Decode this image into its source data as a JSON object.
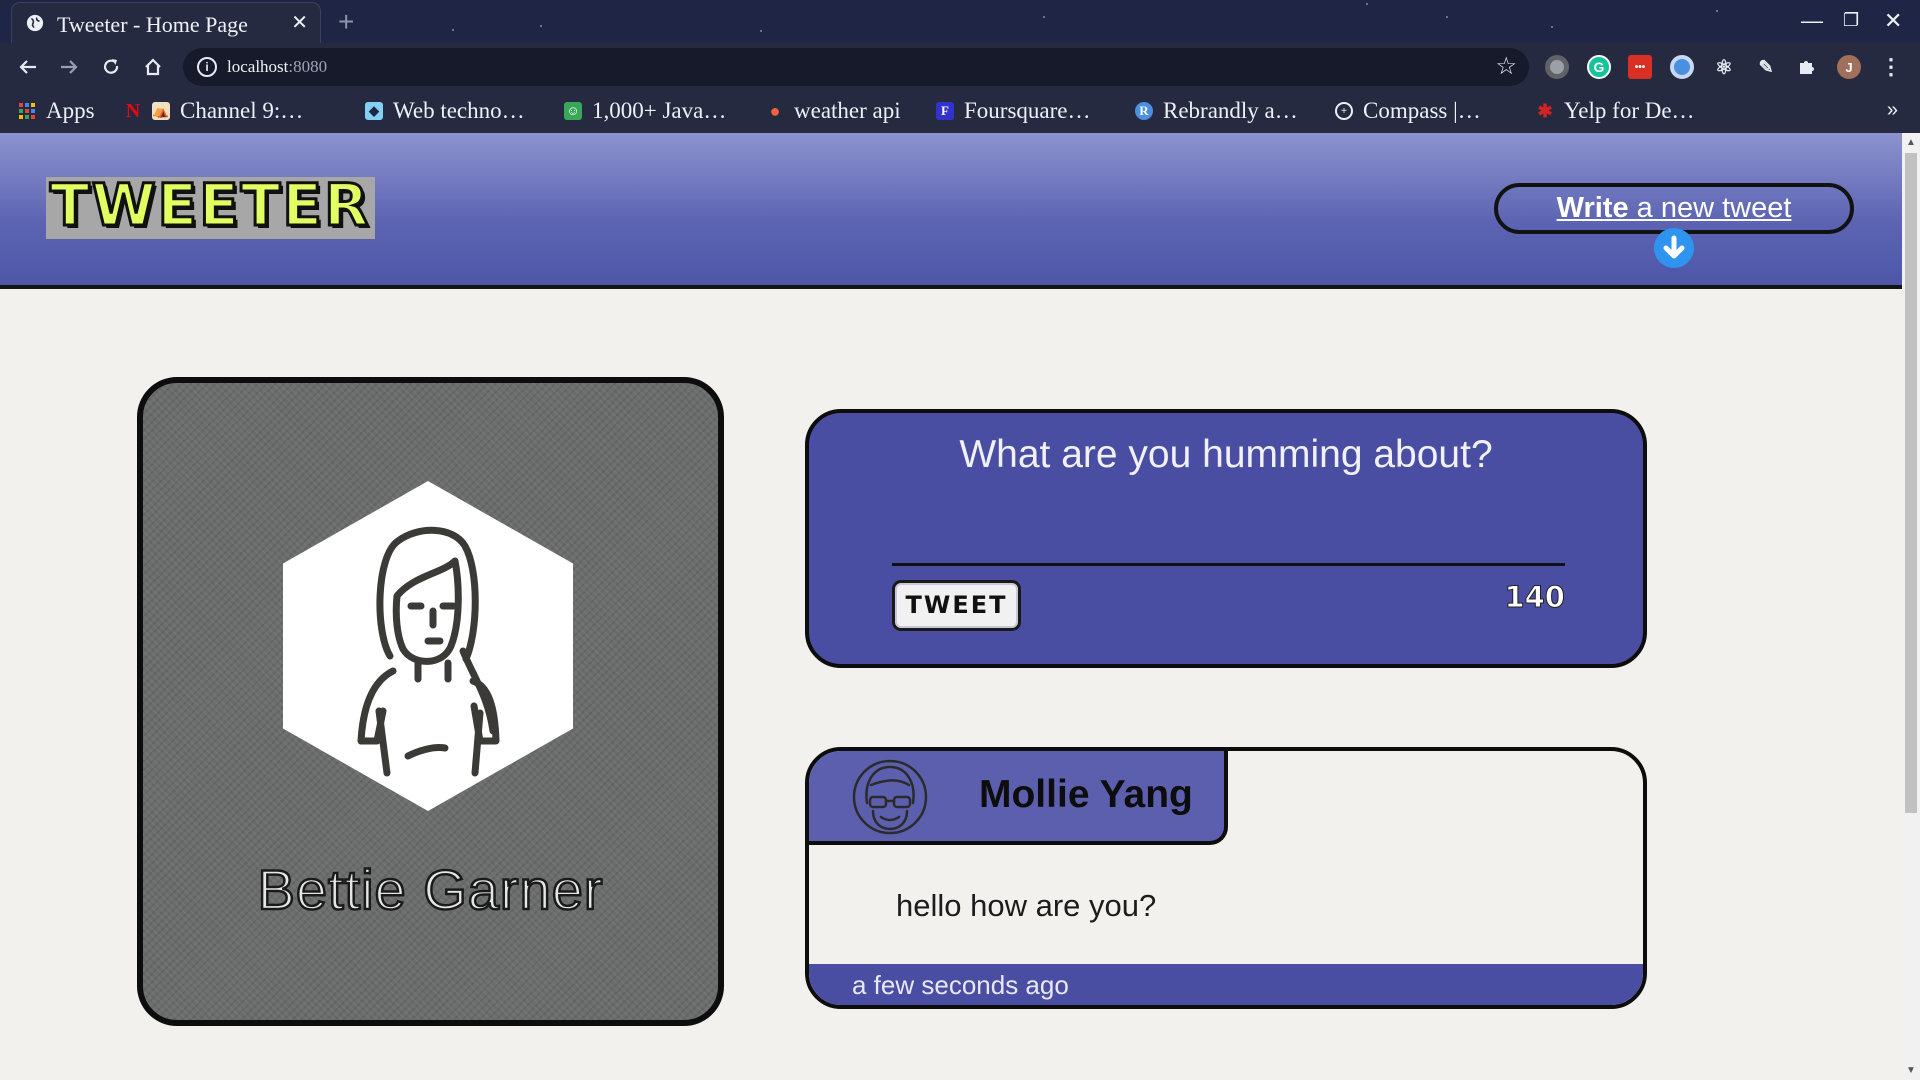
{
  "browser": {
    "tab_title": "Tweeter - Home Page",
    "tab_close": "✕",
    "new_tab": "+",
    "window_controls": {
      "minimize": "—",
      "restore": "❐",
      "close": "✕"
    },
    "url_host": "localhost",
    "url_port": ":8080",
    "profile_initial": "J",
    "extension_g": "G",
    "extension_red": "•••",
    "bookmarks": [
      {
        "label": "Apps",
        "icon": "apps-grid-icon"
      },
      {
        "label": "Channel 9:…",
        "icon": "channel9-icon"
      },
      {
        "label": "Web techno…",
        "icon": "mdn-icon"
      },
      {
        "label": "1,000+ Java…",
        "icon": "java-icon"
      },
      {
        "label": "weather api",
        "icon": "weather-icon"
      },
      {
        "label": "Foursquare…",
        "icon": "foursquare-icon"
      },
      {
        "label": "Rebrandly a…",
        "icon": "rebrandly-icon"
      },
      {
        "label": "Compass |…",
        "icon": "compass-icon"
      },
      {
        "label": "Yelp for De…",
        "icon": "yelp-icon"
      }
    ],
    "bookmarks_more": "»"
  },
  "header": {
    "logo": "TWEETER",
    "write_bold": "Write",
    "write_rest": " a new tweet",
    "down_arrow": "🡇"
  },
  "profile": {
    "name": "Bettie Garner",
    "avatar_icon": "woman-avatar-icon"
  },
  "compose": {
    "placeholder": "What are you humming about?",
    "button_label": "TWEET",
    "counter": "140"
  },
  "tweets": [
    {
      "author": "Mollie Yang",
      "avatar_icon": "woman-glasses-avatar-icon",
      "text": "hello how are you?",
      "time": "a few seconds ago"
    }
  ],
  "colors": {
    "header_gradient_top": "#8c93cf",
    "header_gradient_bottom": "#4e56a8",
    "card_blue": "#4a4ea3",
    "logo_yellow": "#e1ff63",
    "page_bg": "#f3f1ee"
  }
}
